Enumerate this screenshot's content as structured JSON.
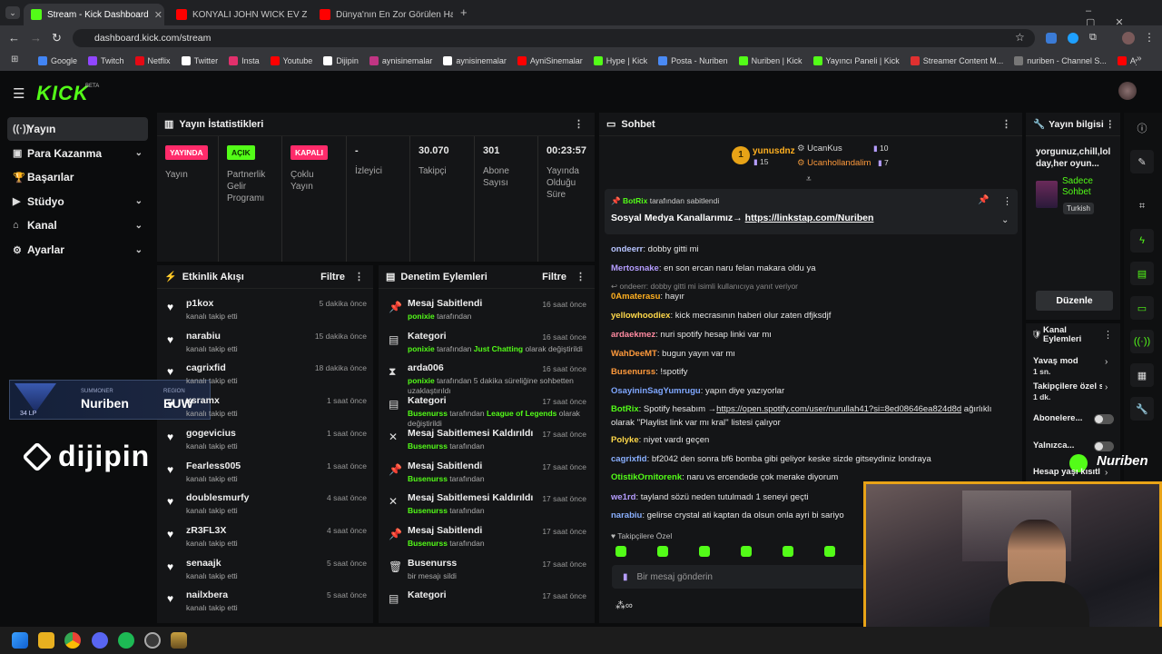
{
  "browser": {
    "tabs": [
      {
        "title": "Stream - Kick Dashboard",
        "fav_color": "#53fc18"
      },
      {
        "title": "KONYALI JOHN WICK EV ZİYARE",
        "fav_color": "#ff0000"
      },
      {
        "title": "Dünya'nın En Zor Görülen Hay",
        "fav_color": "#ff0000"
      }
    ],
    "url": "dashboard.kick.com/stream",
    "bookmarks": [
      "Google",
      "Twitch",
      "Netflix",
      "Twitter",
      "Insta",
      "Youtube",
      "Dijipin",
      "aynisinemalar",
      "aynisinemalar",
      "AyniSinemalar",
      "Hype | Kick",
      "Posta - Nuriben",
      "Nuriben | Kick",
      "Yayıncı Paneli | Kick",
      "Streamer Content M...",
      "nuriben - Channel S...",
      "Aynı Sinemalar - Ça..."
    ]
  },
  "brand": {
    "logo": "KICK",
    "beta": "BETA",
    "accent": "#53fc18"
  },
  "sidebar": {
    "items": [
      {
        "label": "Yayın",
        "icon": "((·))"
      },
      {
        "label": "Para Kazanma",
        "icon": "▣"
      },
      {
        "label": "Başarılar",
        "icon": "🏆"
      },
      {
        "label": "Stüdyo",
        "icon": "▶"
      },
      {
        "label": "Kanal",
        "icon": "⌂"
      },
      {
        "label": "Ayarlar",
        "icon": "⚙"
      }
    ]
  },
  "stats": {
    "title": "Yayın İstatistikleri",
    "cols": [
      {
        "badge": "YAYINDA",
        "label": "Yayın"
      },
      {
        "badge": "AÇIK",
        "label": "Partnerlik Gelir Programı"
      },
      {
        "badge": "KAPALI",
        "label": "Çoklu Yayın"
      },
      {
        "value": "-",
        "label": "İzleyici"
      },
      {
        "value": "30.070",
        "label": "Takipçi"
      },
      {
        "value": "301",
        "label": "Abone Sayısı"
      },
      {
        "value": "00:23:57",
        "label": "Yayında Olduğu Süre"
      }
    ]
  },
  "events": {
    "title": "Etkinlik Akışı",
    "filter": "Filtre",
    "items": [
      {
        "name": "p1kox",
        "sub": "kanalı takip etti",
        "time": "5 dakika önce"
      },
      {
        "name": "narabiu",
        "sub": "kanalı takip etti",
        "time": "15 dakika önce"
      },
      {
        "name": "cagrixfid",
        "sub": "kanalı takip etti",
        "time": "18 dakika önce"
      },
      {
        "name": "xsramx",
        "sub": "kanalı takip etti",
        "time": "1 saat önce"
      },
      {
        "name": "gogevicius",
        "sub": "kanalı takip etti",
        "time": "1 saat önce"
      },
      {
        "name": "Fearless005",
        "sub": "kanalı takip etti",
        "time": "1 saat önce"
      },
      {
        "name": "doublesmurfy",
        "sub": "kanalı takip etti",
        "time": "4 saat önce"
      },
      {
        "name": "zR3FL3X",
        "sub": "kanalı takip etti",
        "time": "4 saat önce"
      },
      {
        "name": "senaajk",
        "sub": "kanalı takip etti",
        "time": "5 saat önce"
      },
      {
        "name": "nailxbera",
        "sub": "kanalı takip etti",
        "time": "5 saat önce"
      }
    ]
  },
  "moderation": {
    "title": "Denetim Eylemleri",
    "filter": "Filtre",
    "items": [
      {
        "icon": "📌",
        "name": "Mesaj Sabitlendi",
        "user": "ponixie",
        "rest": " tarafından",
        "time": "16 saat önce"
      },
      {
        "icon": "▤",
        "name": "Kategori",
        "user": "ponixie",
        "rest": " tarafından ",
        "cat": "Just Chatting",
        "rest2": " olarak değiştirildi",
        "time": "16 saat önce"
      },
      {
        "icon": "⧗",
        "name": "arda006",
        "user": "ponixie",
        "rest": " tarafından 5 dakika süreliğine sohbetten uzaklaştırıldı",
        "time": "16 saat önce"
      },
      {
        "icon": "▤",
        "name": "Kategori",
        "user": "Busenurss",
        "rest": " tarafından ",
        "cat": "League of Legends",
        "rest2": " olarak değiştirildi",
        "time": "17 saat önce"
      },
      {
        "icon": "✕",
        "name": "Mesaj Sabitlemesi Kaldırıldı",
        "user": "Busenurss",
        "rest": " tarafından",
        "time": "17 saat önce"
      },
      {
        "icon": "📌",
        "name": "Mesaj Sabitlendi",
        "user": "Busenurss",
        "rest": " tarafından",
        "time": "17 saat önce"
      },
      {
        "icon": "✕",
        "name": "Mesaj Sabitlemesi Kaldırıldı",
        "user": "Busenurss",
        "rest": " tarafından",
        "time": "17 saat önce"
      },
      {
        "icon": "📌",
        "name": "Mesaj Sabitlendi",
        "user": "Busenurss",
        "rest": " tarafından",
        "time": "17 saat önce"
      },
      {
        "icon": "🗑",
        "name": "Busenurss",
        "user": "",
        "rest": "bir mesajı sildi",
        "time": "17 saat önce"
      },
      {
        "icon": "▤",
        "name": "Kategori",
        "user": "",
        "rest": "",
        "time": "17 saat önce"
      }
    ]
  },
  "chat": {
    "title": "Sohbet",
    "leaders": [
      {
        "rank": "1",
        "name": "yunusdnz",
        "count": "15"
      },
      {
        "name": "UcanKus",
        "count": "10"
      },
      {
        "name": "Ucanhollandalim",
        "count": "7"
      }
    ],
    "pinned": {
      "by": "BotRix",
      "by_suffix": "tarafından sabitlendi",
      "text": "Sosyal Medya Kanallarımız→ ",
      "link": "https://linkstap.com/Nuriben"
    },
    "messages": [
      {
        "user": "ondeerr",
        "color": "#b7c4ff",
        "text": "dobby gitti mi"
      },
      {
        "user": "Mertosnake",
        "color": "#b59dff",
        "text": "en son ercan naru felan makara oldu ya"
      },
      {
        "reply": "↩ ondeerr: dobby gitti mi isimli kullanıcıya yanıt veriyor"
      },
      {
        "user": "0Amaterasu",
        "color": "#ffb020",
        "text": "hayır"
      },
      {
        "user": "yellowhoodiex",
        "color": "#ffd84a",
        "text": "kick mecrasının haberi olur zaten dfjksdjf"
      },
      {
        "user": "ardaekmez",
        "color": "#ff8aa0",
        "text": "nuri spotify hesap linki var mı"
      },
      {
        "user": "WahDeeMT",
        "color": "#ff9a3c",
        "text": "bugun yayın var mı"
      },
      {
        "user": "Busenurss",
        "color": "#ff9a3c",
        "text": "!spotify"
      },
      {
        "user": "OsayininSagYumrugu",
        "color": "#7fa7ff",
        "text": "yapın diye yazıyorlar"
      },
      {
        "user": "BotRix",
        "color": "#53fc18",
        "text": "Spotify hesabım →",
        "link": "https://open.spotify.com/user/nurullah41?si=8ed08646ea824d8d",
        "text2": " ağırlıklı"
      },
      {
        "cont": "olarak ''Playlist link var mı kral'' listesi çalıyor"
      },
      {
        "user": "Polyke",
        "color": "#ffd84a",
        "text": "niyet vardı geçen"
      },
      {
        "user": "cagrixfid",
        "color": "#8ab0ff",
        "text": "bf2042 den sonra bf6 bomba gibi geliyor keske sizde gitseydiniz londraya"
      },
      {
        "user": "OtistikOrnitorenk",
        "color": "#53fc18",
        "text": "naru vs ercendede çok merake diyorum"
      },
      {
        "user": "we1rd",
        "color": "#b59dff",
        "text": "tayland sözü neden tutulmadı 1 seneyi geçti"
      },
      {
        "user": "narabiu",
        "color": "#8ab0ff",
        "text": "gelirse crystal ati kaptan da olsun onla ayri bi sariyo"
      }
    ],
    "followers_label": "Takipçilere Özel",
    "input_placeholder": "Bir mesaj gönderin"
  },
  "info": {
    "title": "Yayın bilgisi",
    "stream_title": "yorgunuz,chill,lol day,her oyun...",
    "category": "Sadece Sohbet",
    "language": "Turkish",
    "edit_button": "Düzenle"
  },
  "channel_actions": {
    "title": "Kanal Eylemleri",
    "items": [
      {
        "label": "Yavaş mod",
        "sub": "1 sn."
      },
      {
        "label": "Takipçilere özel s",
        "sub": "1 dk."
      },
      {
        "label": "Abonelere..."
      },
      {
        "label": "Yalnızca..."
      },
      {
        "label": "Hesap yaşı kısıtl"
      }
    ]
  },
  "overlay": {
    "summoner_label": "SUMMONER",
    "summoner": "Nuriben",
    "region_label": "REGION",
    "region": "EUW",
    "lp": "34 LP",
    "sponsor": "dijipin",
    "cam_name": "Nuriben"
  }
}
